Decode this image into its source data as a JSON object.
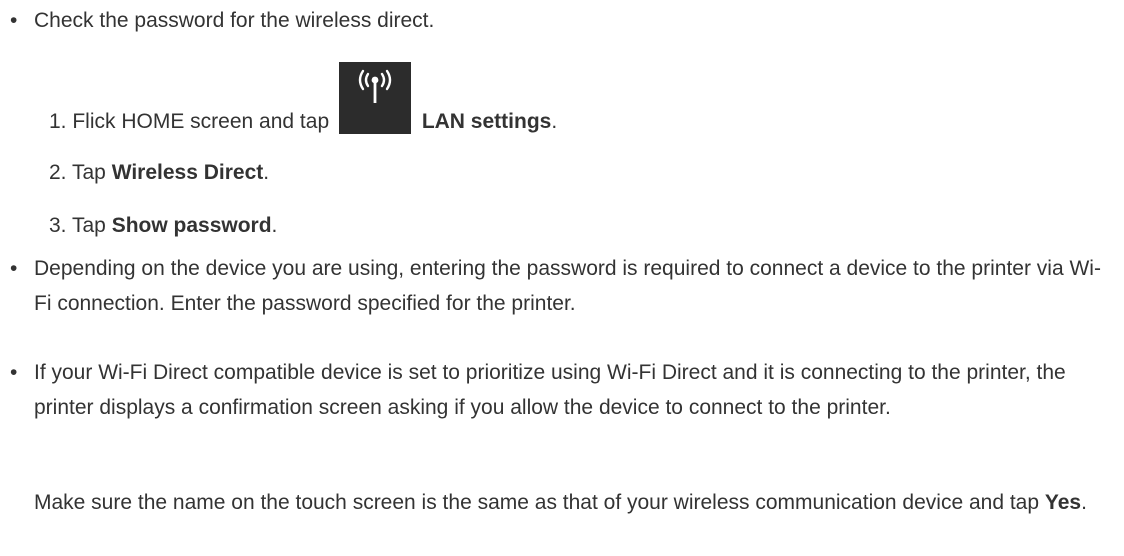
{
  "bullets": {
    "b1": {
      "marker": "•",
      "text": "Check the password for the wireless direct."
    },
    "b2": {
      "marker": "•",
      "text": "Depending on the device you are using, entering the password is required to connect a device to the printer via Wi-Fi connection. Enter the password specified for the printer."
    },
    "b3": {
      "marker": "•",
      "text": "If your Wi-Fi Direct compatible device is set to prioritize using Wi-Fi Direct and it is connecting to the printer, the printer displays a confirmation screen asking if you allow the device to connect to the printer."
    }
  },
  "steps": {
    "s1": {
      "num": "1.",
      "prefix": "Flick HOME screen and tap",
      "icon": "wireless-antenna-icon",
      "bold": "LAN settings",
      "suffix": "."
    },
    "s2": {
      "num": "2.",
      "prefix": "Tap",
      "bold": "Wireless Direct",
      "suffix": "."
    },
    "s3": {
      "num": "3.",
      "prefix": "Tap",
      "bold": "Show password",
      "suffix": "."
    }
  },
  "note": {
    "prefix": "Make sure the name on the touch screen is the same as that of your wireless communication device and tap",
    "bold": "Yes",
    "suffix": "."
  },
  "colors": {
    "text": "#333333",
    "icon_background": "#2c2c2c",
    "icon_foreground": "#ffffff"
  }
}
